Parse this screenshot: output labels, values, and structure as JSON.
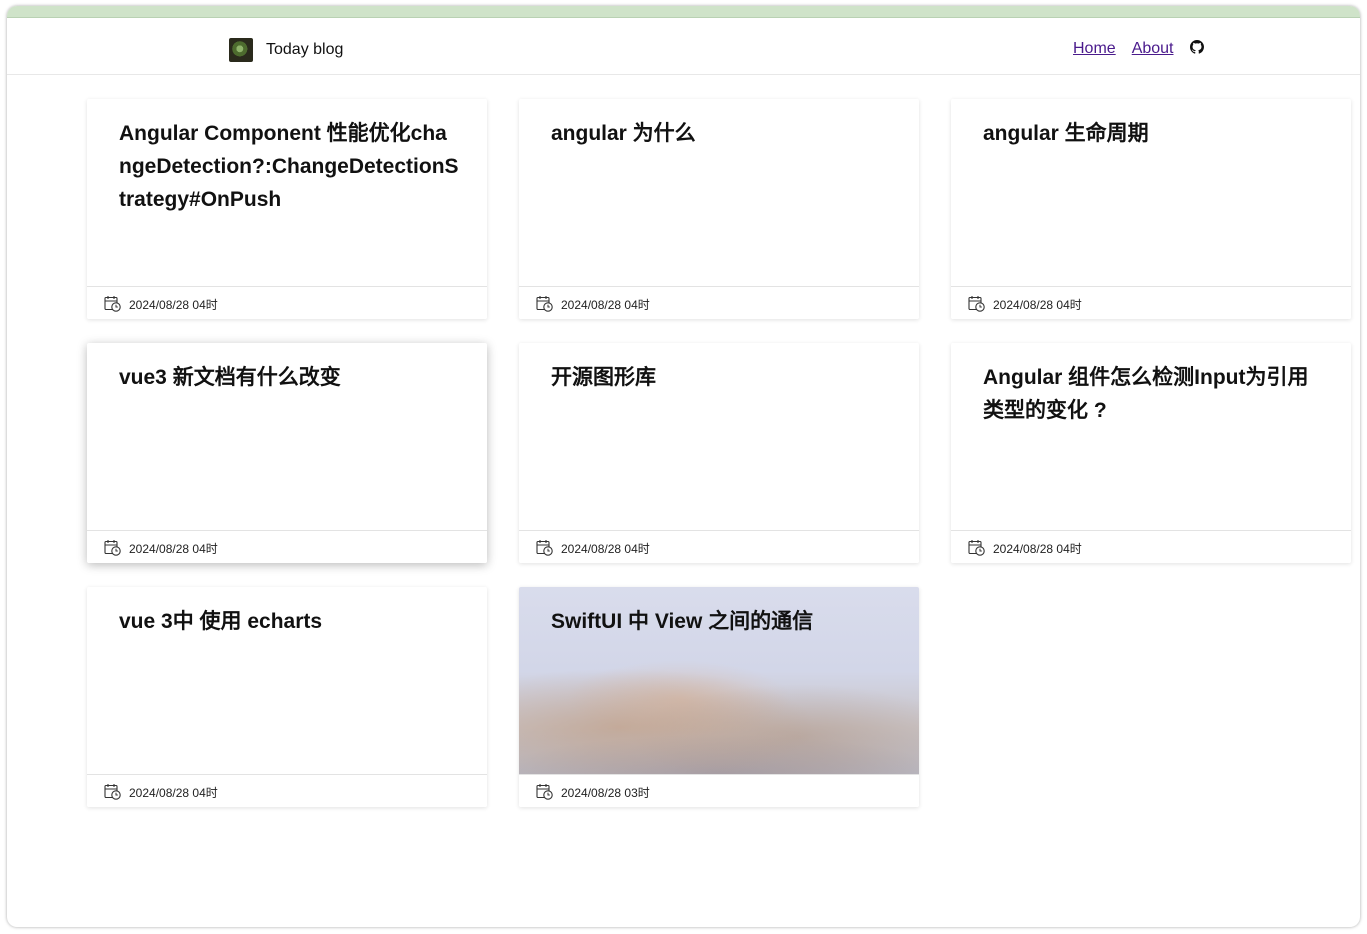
{
  "header": {
    "brand_title": "Today blog",
    "nav": {
      "home": "Home",
      "about": "About"
    }
  },
  "posts": [
    {
      "title": "Angular Component 性能优化changeDetection?:ChangeDetectionStrategy#OnPush",
      "date": "2024/08/28 04时"
    },
    {
      "title": "angular 为什么",
      "date": "2024/08/28 04时"
    },
    {
      "title": "angular 生命周期",
      "date": "2024/08/28 04时"
    },
    {
      "title": "vue3 新文档有什么改变",
      "date": "2024/08/28 04时"
    },
    {
      "title": "开源图形库",
      "date": "2024/08/28 04时"
    },
    {
      "title": "Angular 组件怎么检测Input为引用类型的变化 ?",
      "date": "2024/08/28 04时"
    },
    {
      "title": "vue 3中 使用 echarts",
      "date": "2024/08/28 04时"
    },
    {
      "title": "SwiftUI 中 View 之间的通信",
      "date": "2024/08/28 03时"
    }
  ],
  "icons": {
    "github": "github-icon",
    "calendar": "calendar-clock-icon"
  },
  "colors": {
    "link": "#4a1a8c",
    "top_strip": "#cfe3c9"
  }
}
